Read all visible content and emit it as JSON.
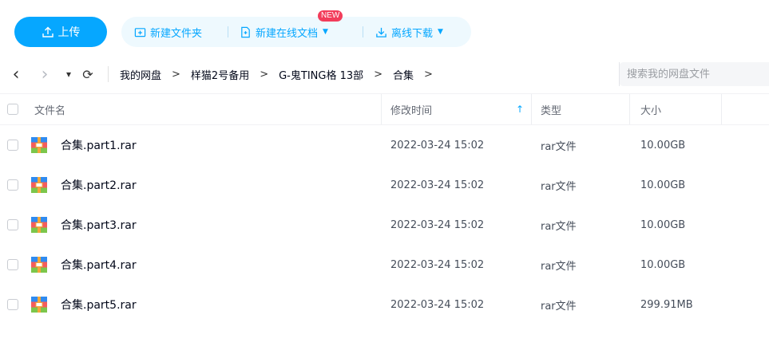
{
  "toolbar": {
    "upload_label": "上传",
    "new_folder_label": "新建文件夹",
    "new_online_doc_label": "新建在线文档",
    "new_badge": "NEW",
    "offline_download_label": "离线下载",
    "accent_color": "#06a7ff"
  },
  "nav": {
    "back": "‹",
    "forward": "›",
    "history": "▾",
    "refresh": "⟳",
    "breadcrumb": [
      "我的网盘",
      "样猫2号备用",
      "G-鬼TING格 13部",
      "合集"
    ],
    "separator": ">",
    "search_placeholder": "搜索我的网盘文件"
  },
  "table": {
    "headers": {
      "name": "文件名",
      "modified": "修改时间",
      "type": "类型",
      "size": "大小"
    },
    "sort_icon": "↑",
    "rows": [
      {
        "name": "合集.part1.rar",
        "modified": "2022-03-24 15:02",
        "type": "rar文件",
        "size": "10.00GB"
      },
      {
        "name": "合集.part2.rar",
        "modified": "2022-03-24 15:02",
        "type": "rar文件",
        "size": "10.00GB"
      },
      {
        "name": "合集.part3.rar",
        "modified": "2022-03-24 15:02",
        "type": "rar文件",
        "size": "10.00GB"
      },
      {
        "name": "合集.part4.rar",
        "modified": "2022-03-24 15:02",
        "type": "rar文件",
        "size": "10.00GB"
      },
      {
        "name": "合集.part5.rar",
        "modified": "2022-03-24 15:02",
        "type": "rar文件",
        "size": "299.91MB"
      }
    ]
  }
}
